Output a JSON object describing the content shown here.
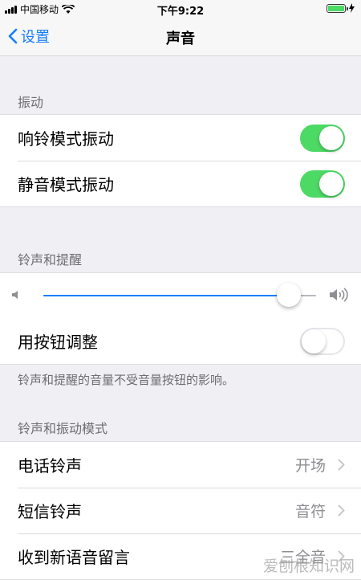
{
  "status_bar": {
    "carrier": "中国移动",
    "time": "下午9:22"
  },
  "nav": {
    "back_label": "设置",
    "title": "声音"
  },
  "vibration": {
    "header": "振动",
    "items": [
      {
        "label": "响铃模式振动",
        "on": true
      },
      {
        "label": "静音模式振动",
        "on": true
      }
    ]
  },
  "ringer": {
    "header": "铃声和提醒",
    "volume_level": 0.9,
    "adjust_label": "用按钮调整",
    "adjust_on": false,
    "footnote": "铃声和提醒的音量不受音量按钮的影响。"
  },
  "patterns": {
    "header": "铃声和振动模式",
    "items": [
      {
        "label": "电话铃声",
        "value": "开场"
      },
      {
        "label": "短信铃声",
        "value": "音符"
      },
      {
        "label": "收到新语音留言",
        "value": "三全音"
      }
    ]
  },
  "watermark": "爱刨根知识网",
  "colors": {
    "accent": "#157efb",
    "toggle_on": "#4cd964",
    "background": "#efeff4"
  }
}
